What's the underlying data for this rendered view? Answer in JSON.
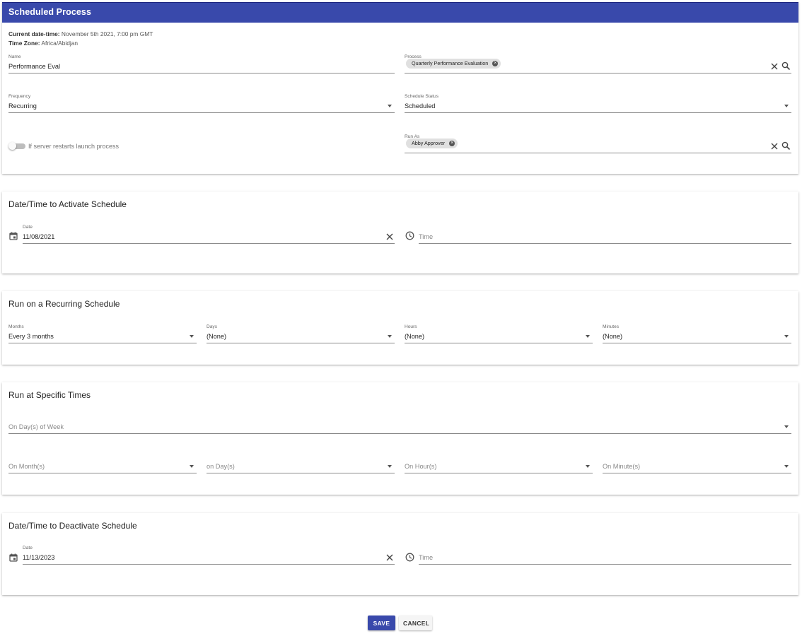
{
  "header": {
    "title": "Scheduled Process"
  },
  "info": {
    "datetime_label": "Current date-time:",
    "datetime_value": "November 5th 2021, 7:00 pm GMT",
    "timezone_label": "Time Zone:",
    "timezone_value": "Africa/Abidjan"
  },
  "form": {
    "name": {
      "label": "Name",
      "value": "Performance Eval"
    },
    "process": {
      "label": "Process",
      "chip": "Quarterly Performance Evaluation"
    },
    "frequency": {
      "label": "Frequency",
      "value": "Recurring"
    },
    "schedule_status": {
      "label": "Schedule Status",
      "value": "Scheduled"
    },
    "restart_toggle": {
      "label": "If server restarts launch process",
      "checked": false
    },
    "run_as": {
      "label": "Run As",
      "chip": "Abby Approver"
    }
  },
  "activate": {
    "title": "Date/Time to Activate Schedule",
    "date": {
      "label": "Date",
      "value": "11/08/2021"
    },
    "time": {
      "placeholder": "Time"
    }
  },
  "recurring": {
    "title": "Run on a Recurring Schedule",
    "months": {
      "label": "Months",
      "value": "Every 3 months"
    },
    "days": {
      "label": "Days",
      "value": "(None)"
    },
    "hours": {
      "label": "Hours",
      "value": "(None)"
    },
    "minutes": {
      "label": "Minutes",
      "value": "(None)"
    }
  },
  "specific": {
    "title": "Run at Specific Times",
    "days_of_week": "On Day(s) of Week",
    "months": "On Month(s)",
    "days": "on Day(s)",
    "hours": "On Hour(s)",
    "minutes": "On Minute(s)"
  },
  "deactivate": {
    "title": "Date/Time to Deactivate Schedule",
    "date": {
      "label": "Date",
      "value": "11/13/2023"
    },
    "time": {
      "placeholder": "Time"
    }
  },
  "actions": {
    "save": "SAVE",
    "cancel": "CANCEL"
  },
  "colors": {
    "primary": "#3949ab",
    "chip": "#e0e0e0"
  }
}
